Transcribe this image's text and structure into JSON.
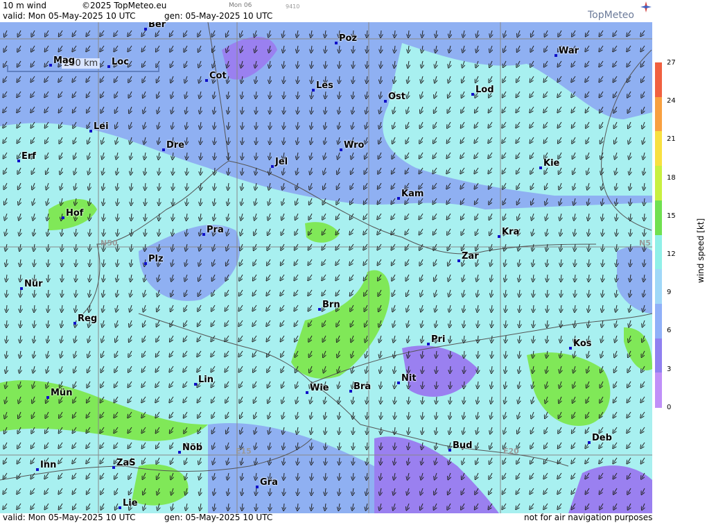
{
  "header": {
    "product": "10 m wind",
    "copyright": "©2025 TopMeteo.eu",
    "valid": "valid:  Mon  05-May-2025  10 UTC",
    "gen": "gen: 05-May-2025 10 UTC",
    "small_day": "Mon 06",
    "small_code": "9410",
    "logo": "TopMeteo"
  },
  "scale_bar": {
    "label": "200 km"
  },
  "cities": [
    {
      "name": "Ber"
    },
    {
      "name": "Poz"
    },
    {
      "name": "War"
    },
    {
      "name": "Mag"
    },
    {
      "name": "Loc"
    },
    {
      "name": "Cot"
    },
    {
      "name": "Les"
    },
    {
      "name": "Ost"
    },
    {
      "name": "Lod"
    },
    {
      "name": "Lei"
    },
    {
      "name": "Erf"
    },
    {
      "name": "Dre"
    },
    {
      "name": "Wro"
    },
    {
      "name": "Jel"
    },
    {
      "name": "Kie"
    },
    {
      "name": "Kam"
    },
    {
      "name": "Hof"
    },
    {
      "name": "Pra"
    },
    {
      "name": "Kra"
    },
    {
      "name": "Zar"
    },
    {
      "name": "Plz"
    },
    {
      "name": "Nür"
    },
    {
      "name": "Brn"
    },
    {
      "name": "Reg"
    },
    {
      "name": "Pri"
    },
    {
      "name": "Kos"
    },
    {
      "name": "Lin"
    },
    {
      "name": "Nit"
    },
    {
      "name": "Mün"
    },
    {
      "name": "Wie"
    },
    {
      "name": "Bra"
    },
    {
      "name": "Deb"
    },
    {
      "name": "Bud"
    },
    {
      "name": "Nöb"
    },
    {
      "name": "Inn"
    },
    {
      "name": "ZaS"
    },
    {
      "name": "Gra"
    },
    {
      "name": "Lie"
    }
  ],
  "grid_labels": {
    "n50_left": "N50",
    "n50_right": "N5",
    "e15": "E15",
    "e20": "E20"
  },
  "colorbar": {
    "title": "wind  speed  [kt]",
    "ticks": [
      "27",
      "24",
      "21",
      "18",
      "15",
      "12",
      "9",
      "6",
      "3",
      "0"
    ],
    "colors": [
      "#f06040",
      "#f8a040",
      "#f8e040",
      "#c8f040",
      "#70e050",
      "#90f0e8",
      "#a0d8f8",
      "#90b0f8",
      "#9080f0",
      "#c090f8"
    ]
  },
  "footer": {
    "valid": "valid:  Mon  05-May-2025  10 UTC",
    "gen": "gen: 05-May-2025 10 UTC",
    "note": "not for air navigation purposes"
  }
}
